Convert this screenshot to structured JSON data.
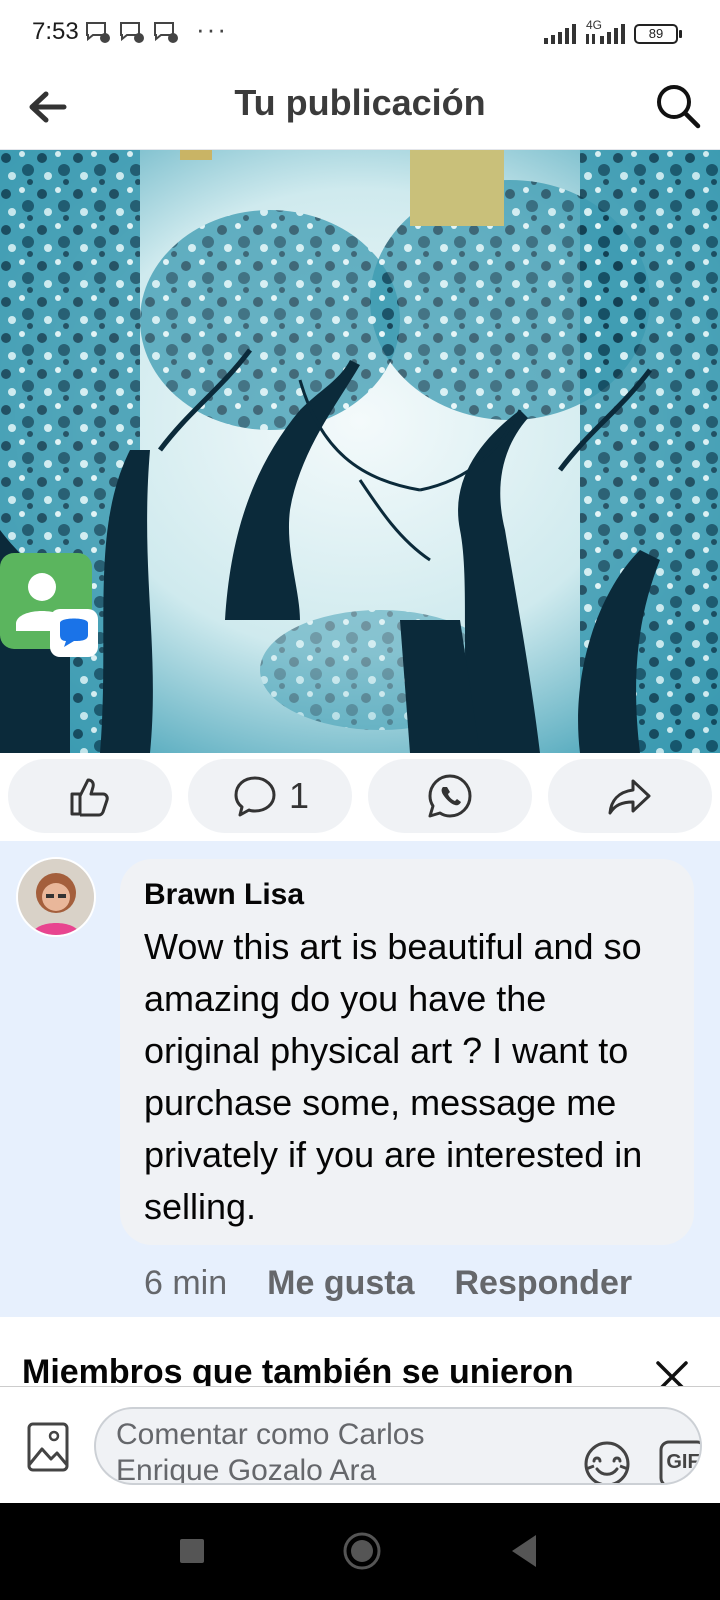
{
  "status_bar": {
    "time": "7:53",
    "notification_icons": [
      "chat-notification-icon",
      "chat-notification-icon",
      "chat-notification-icon"
    ],
    "more_indicator": "···",
    "network": "4G",
    "battery": "89"
  },
  "header": {
    "title": "Tu publicación",
    "back_icon": "arrow-left-icon",
    "search_icon": "search-icon"
  },
  "post": {
    "image_description_icon": "post-photo",
    "floating_icon": "contacts-messages-icon"
  },
  "actions": {
    "like_icon": "thumbs-up-icon",
    "comment_icon": "comment-icon",
    "comment_count": "1",
    "whatsapp_icon": "whatsapp-icon",
    "share_icon": "share-icon"
  },
  "comment": {
    "author": "Brawn Lisa",
    "text": "Wow this art is beautiful and so amazing do you have the original physical art ? I want to purchase some, message me privately if you are interested in selling.",
    "time": "6 min",
    "like_label": "Me gusta",
    "reply_label": "Responder"
  },
  "suggestions": {
    "title": "Miembros que también se unieron",
    "close_icon": "close-icon"
  },
  "composer": {
    "placeholder": "Comentar como Carlos Enrique Gozalo Ara",
    "photo_icon": "photo-icon",
    "sticker_icon": "sticker-icon",
    "gif_label": "GIF",
    "emoji_icon": "emoji-icon"
  },
  "colors": {
    "comment_bg": "#e7f0fd",
    "bubble_bg": "#f0f2f5",
    "secondary_text": "#65676b",
    "image_tint": "#2e8fa6"
  }
}
